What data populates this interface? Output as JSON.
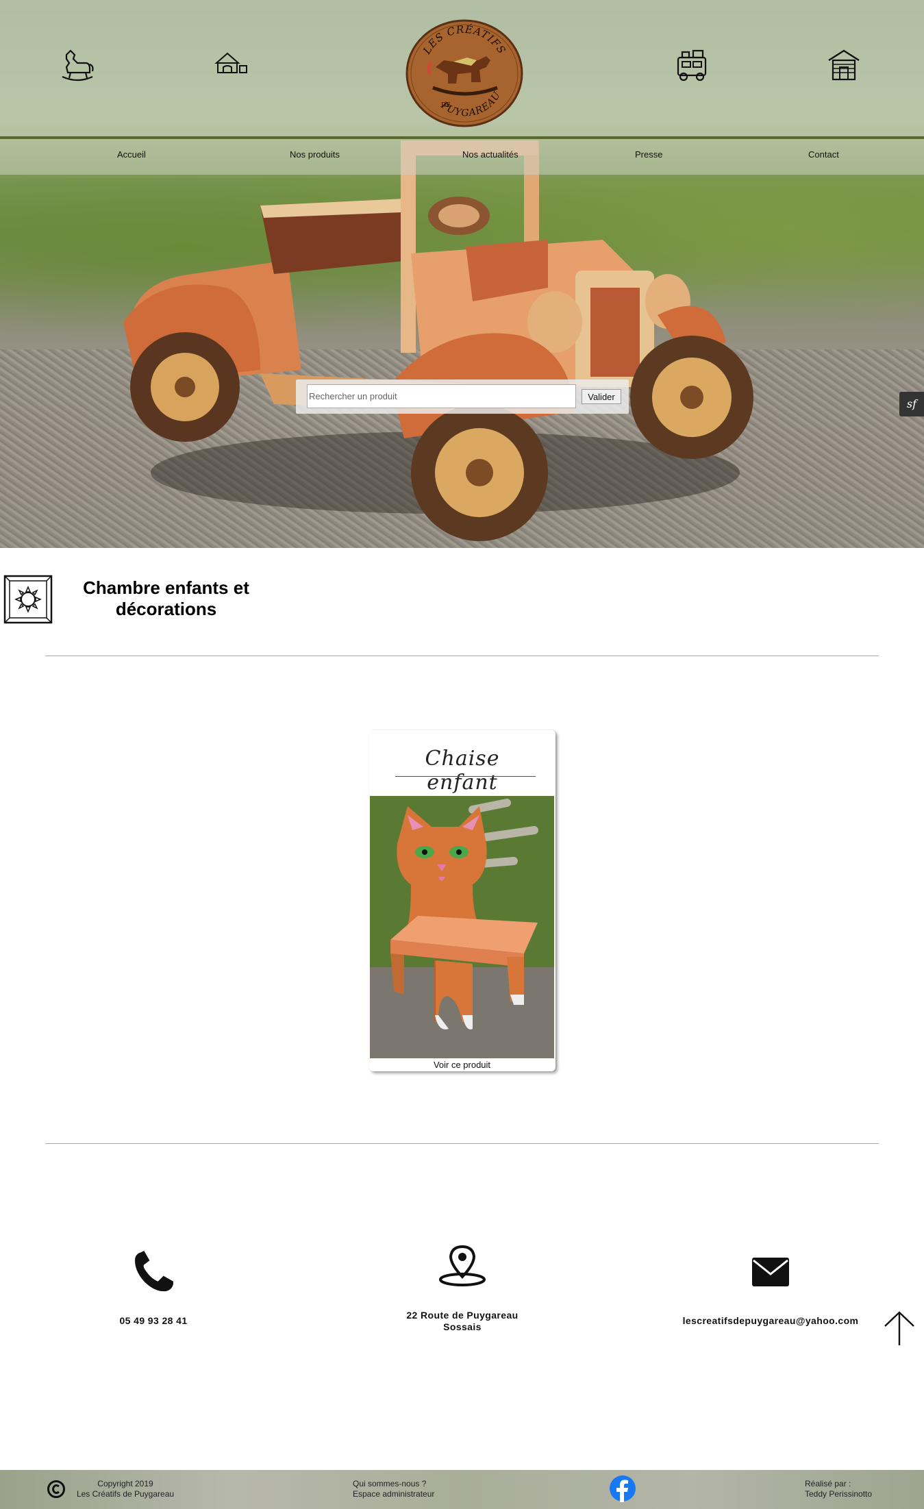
{
  "header": {
    "logo_text_top": "LES CRÉATIFS",
    "logo_text_de": "DE",
    "logo_text_bottom": "PUYGAREAU",
    "icons": [
      "rocking-horse-icon",
      "house-icon",
      "train-icon",
      "cabin-icon"
    ]
  },
  "nav": {
    "items": [
      {
        "label": "Accueil"
      },
      {
        "label": "Nos produits"
      },
      {
        "label": "Nos actualités"
      },
      {
        "label": "Presse"
      },
      {
        "label": "Contact"
      }
    ]
  },
  "search": {
    "placeholder": "Rechercher un produit",
    "button_label": "Valider"
  },
  "debug_badge": "sf",
  "category": {
    "title_line1": "Chambre enfants et",
    "title_line2": "décorations"
  },
  "products": [
    {
      "title": "Chaise enfant",
      "link_label": "Voir ce produit"
    }
  ],
  "contact": {
    "phone": "05 49 93 28 41",
    "address_line1": "22 Route de Puygareau",
    "address_line2": "Sossais",
    "email": "lescreatifsdepuygareau@yahoo.com"
  },
  "footer": {
    "copyright_line1": "Copyright 2019",
    "copyright_line2": "Les Créatifs de Puygareau",
    "about_label": "Qui sommes-nous ?",
    "admin_label": "Espace administrateur",
    "credit_line1": "Réalisé par :",
    "credit_line2": "Teddy Perissinotto"
  },
  "colors": {
    "accent_line": "#5b6a2a",
    "facebook": "#1877f2"
  }
}
